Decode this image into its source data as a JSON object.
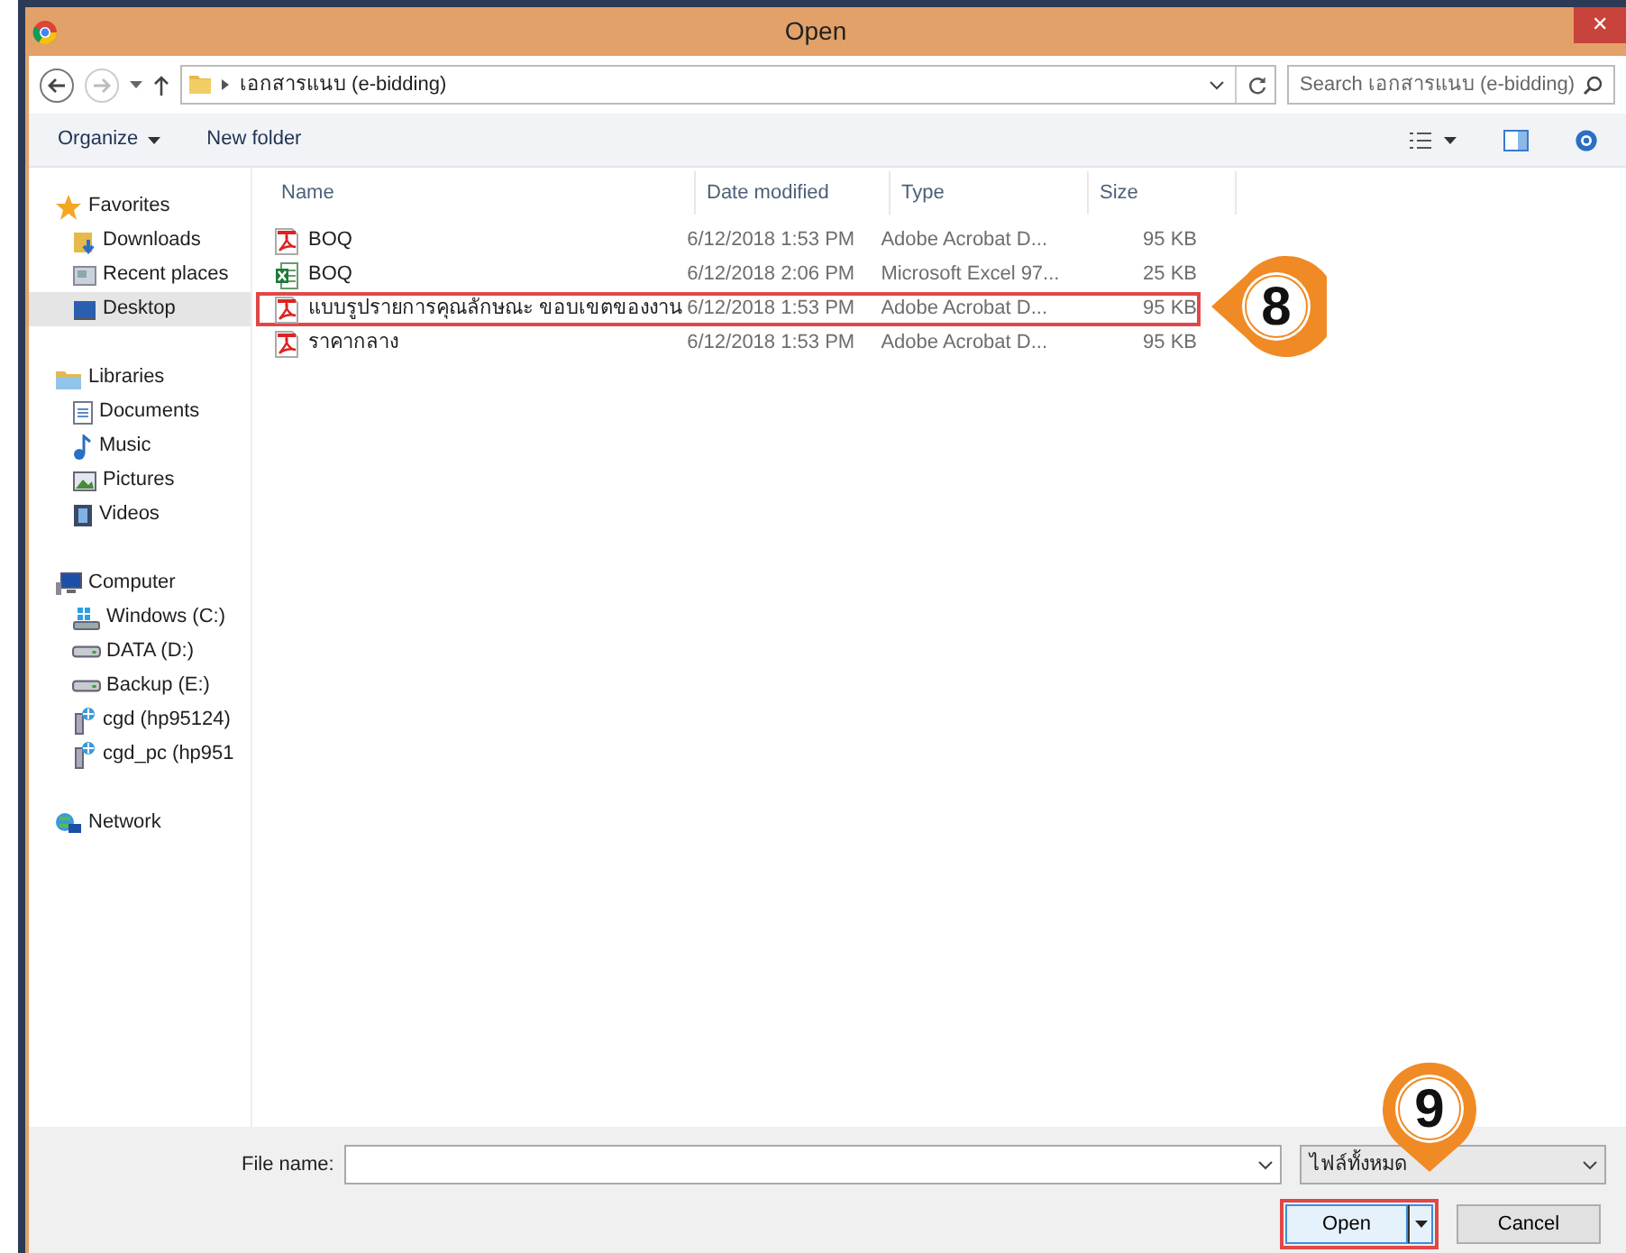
{
  "window": {
    "title": "Open",
    "close": "✕"
  },
  "address": {
    "path": "เอกสารแนบ (e-bidding)",
    "search_placeholder": "Search เอกสารแนบ (e-bidding)"
  },
  "toolbar": {
    "organize": "Organize",
    "new_folder": "New folder"
  },
  "sidebar": [
    {
      "label": "Favorites",
      "kind": "star",
      "selected": false,
      "children": [
        {
          "label": "Downloads",
          "kind": "downloads",
          "selected": false
        },
        {
          "label": "Recent places",
          "kind": "recent",
          "selected": false
        },
        {
          "label": "Desktop",
          "kind": "desktop",
          "selected": true
        }
      ]
    },
    {
      "label": "Libraries",
      "kind": "library",
      "selected": false,
      "children": [
        {
          "label": "Documents",
          "kind": "doc",
          "selected": false
        },
        {
          "label": "Music",
          "kind": "music",
          "selected": false
        },
        {
          "label": "Pictures",
          "kind": "picture",
          "selected": false
        },
        {
          "label": "Videos",
          "kind": "video",
          "selected": false
        }
      ]
    },
    {
      "label": "Computer",
      "kind": "computer",
      "selected": false,
      "children": [
        {
          "label": "Windows (C:)",
          "kind": "windrive",
          "selected": false
        },
        {
          "label": "DATA (D:)",
          "kind": "drive",
          "selected": false
        },
        {
          "label": "Backup (E:)",
          "kind": "drive",
          "selected": false
        },
        {
          "label": "cgd (hp95124)",
          "kind": "netdrive",
          "selected": false
        },
        {
          "label": "cgd_pc (hp951",
          "kind": "netdrive",
          "selected": false
        }
      ]
    },
    {
      "label": "Network",
      "kind": "network",
      "selected": false
    }
  ],
  "table": {
    "columns": [
      "Name",
      "Date modified",
      "Type",
      "Size"
    ],
    "rows": [
      {
        "name": "BOQ",
        "kind": "pdf",
        "date": "6/12/2018 1:53 PM",
        "type": "Adobe Acrobat D...",
        "size": "95 KB",
        "highlighted": false
      },
      {
        "name": "BOQ",
        "kind": "excel",
        "date": "6/12/2018 2:06 PM",
        "type": "Microsoft Excel 97...",
        "size": "25 KB",
        "highlighted": false
      },
      {
        "name": "แบบรูปรายการคุณลักษณะ ขอบเขตของงาน",
        "kind": "pdf",
        "date": "6/12/2018 1:53 PM",
        "type": "Adobe Acrobat D...",
        "size": "95 KB",
        "highlighted": true
      },
      {
        "name": "ราคากลาง",
        "kind": "pdf",
        "date": "6/12/2018 1:53 PM",
        "type": "Adobe Acrobat D...",
        "size": "95 KB",
        "highlighted": false
      }
    ]
  },
  "footer": {
    "file_name_label": "File name:",
    "filter": "ไฟล์ทั้งหมด",
    "open": "Open",
    "open_highlighted": true,
    "cancel": "Cancel"
  },
  "annotations": [
    {
      "label": "8"
    },
    {
      "label": "9"
    }
  ]
}
